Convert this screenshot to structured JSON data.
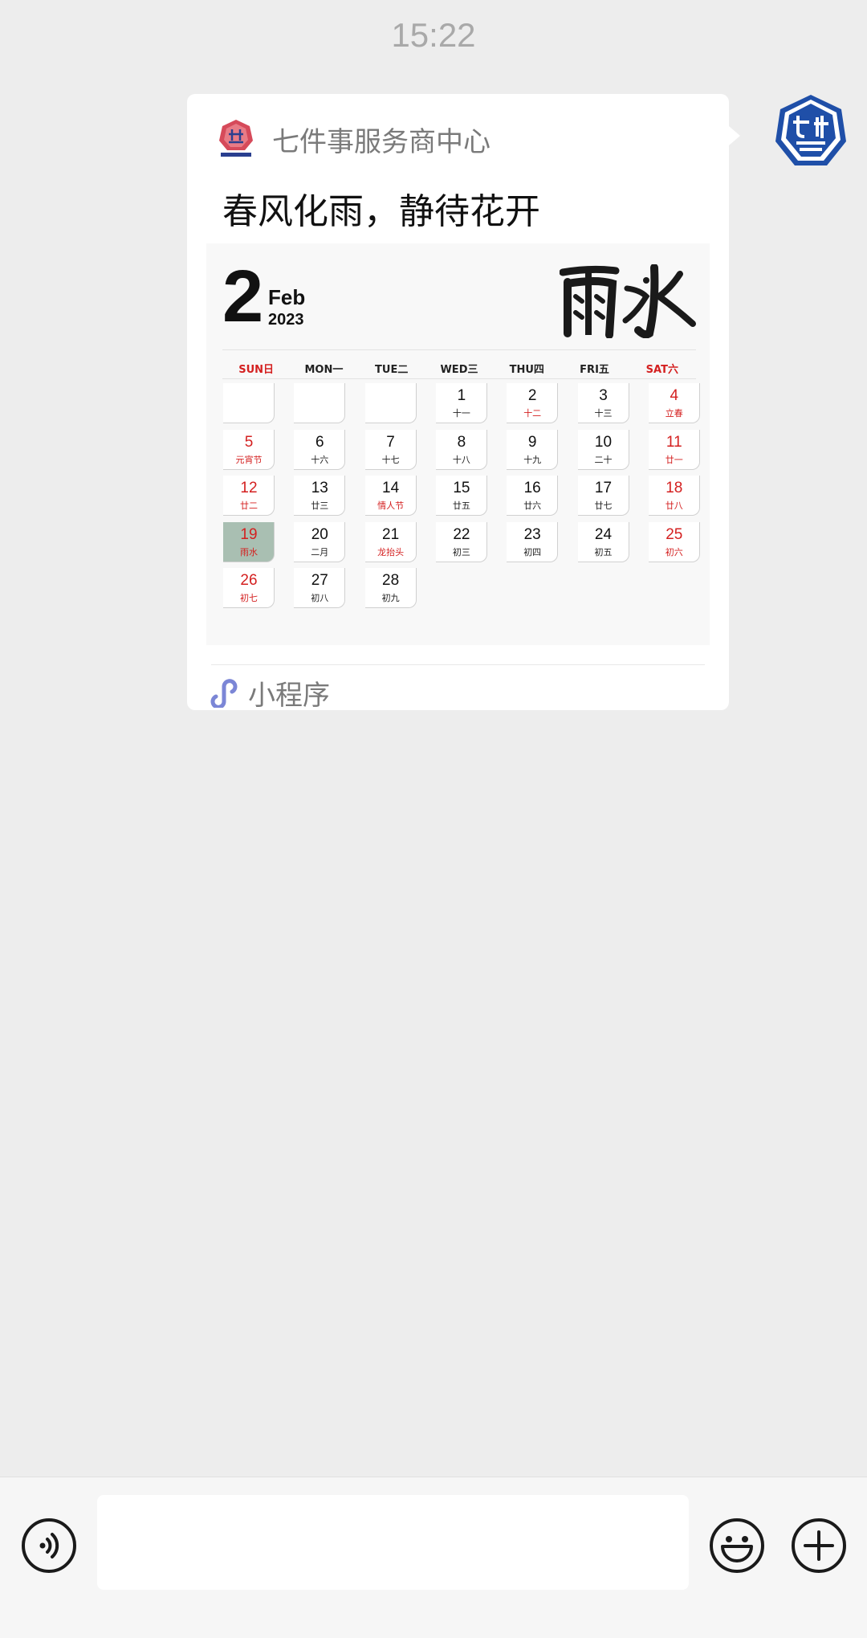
{
  "status": {
    "time": "15:22"
  },
  "message": {
    "source_name": "七件事服务商中心",
    "title": "春风化雨，静待花开",
    "footer_label": "小程序"
  },
  "calendar": {
    "day": "2",
    "month": "Feb",
    "year": "2023",
    "solar_term_art": "雨水",
    "weekdays": [
      "SUN日",
      "MON一",
      "TUE二",
      "WED三",
      "THU四",
      "FRI五",
      "SAT六"
    ],
    "weeks": [
      [
        null,
        null,
        null,
        {
          "d": "1",
          "s": "十一"
        },
        {
          "d": "2",
          "s": "十二",
          "sred": true
        },
        {
          "d": "3",
          "s": "十三"
        },
        {
          "d": "4",
          "s": "立春",
          "red": true
        }
      ],
      [
        {
          "d": "5",
          "s": "元宵节",
          "red": true
        },
        {
          "d": "6",
          "s": "十六"
        },
        {
          "d": "7",
          "s": "十七"
        },
        {
          "d": "8",
          "s": "十八"
        },
        {
          "d": "9",
          "s": "十九"
        },
        {
          "d": "10",
          "s": "二十"
        },
        {
          "d": "11",
          "s": "廿一",
          "red": true
        }
      ],
      [
        {
          "d": "12",
          "s": "廿二",
          "red": true
        },
        {
          "d": "13",
          "s": "廿三"
        },
        {
          "d": "14",
          "s": "情人节",
          "sred": true
        },
        {
          "d": "15",
          "s": "廿五"
        },
        {
          "d": "16",
          "s": "廿六"
        },
        {
          "d": "17",
          "s": "廿七"
        },
        {
          "d": "18",
          "s": "廿八",
          "red": true
        }
      ],
      [
        {
          "d": "19",
          "s": "雨水",
          "red": true,
          "selected": true
        },
        {
          "d": "20",
          "s": "二月"
        },
        {
          "d": "21",
          "s": "龙抬头",
          "sred": true
        },
        {
          "d": "22",
          "s": "初三"
        },
        {
          "d": "23",
          "s": "初四"
        },
        {
          "d": "24",
          "s": "初五"
        },
        {
          "d": "25",
          "s": "初六",
          "red": true
        }
      ],
      [
        {
          "d": "26",
          "s": "初七",
          "red": true
        },
        {
          "d": "27",
          "s": "初八"
        },
        {
          "d": "28",
          "s": "初九"
        },
        null,
        null,
        null,
        null
      ]
    ]
  },
  "colors": {
    "accent_red": "#d42020",
    "selected_bg": "#a9bfb2",
    "chat_bg": "#ededed"
  },
  "icons": [
    "avatar-logo",
    "source-logo",
    "mini-program-icon",
    "voice-icon",
    "emoji-icon",
    "plus-icon"
  ]
}
